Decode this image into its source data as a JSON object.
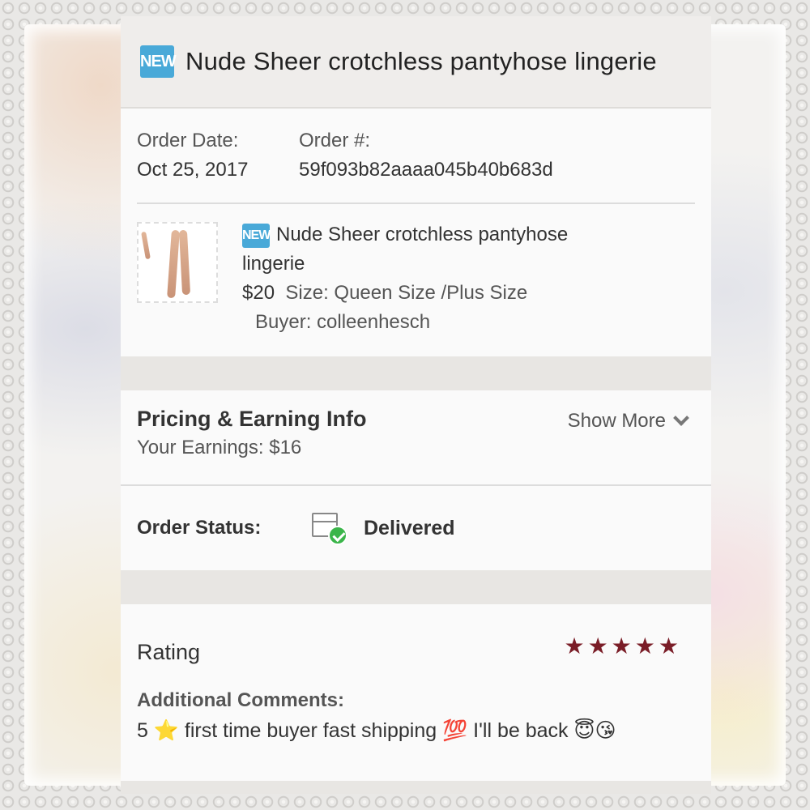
{
  "header": {
    "badge": "NEW",
    "title": "Nude Sheer crotchless pantyhose lingerie"
  },
  "order": {
    "date_label": "Order Date:",
    "date_value": "Oct 25, 2017",
    "number_label": "Order #:",
    "number_value": "59f093b82aaaa045b40b683d"
  },
  "item": {
    "badge": "NEW",
    "title_line1": "Nude Sheer crotchless pantyhose",
    "title_line2": "lingerie",
    "price": "$20",
    "size": "Size: Queen Size /Plus Size",
    "buyer": "Buyer: colleenhesch"
  },
  "pricing": {
    "title": "Pricing & Earning Info",
    "earnings": "Your Earnings: $16",
    "show_more": "Show More"
  },
  "status": {
    "label": "Order Status:",
    "value": "Delivered"
  },
  "rating": {
    "title": "Rating",
    "stars": 5,
    "star_color": "#7a1d27",
    "comments_label": "Additional Comments:",
    "comments": "5 ⭐ first time buyer fast shipping 💯 I'll be back 😇😘"
  },
  "colors": {
    "badge": "#49a9d8",
    "check": "#3bb54a"
  }
}
